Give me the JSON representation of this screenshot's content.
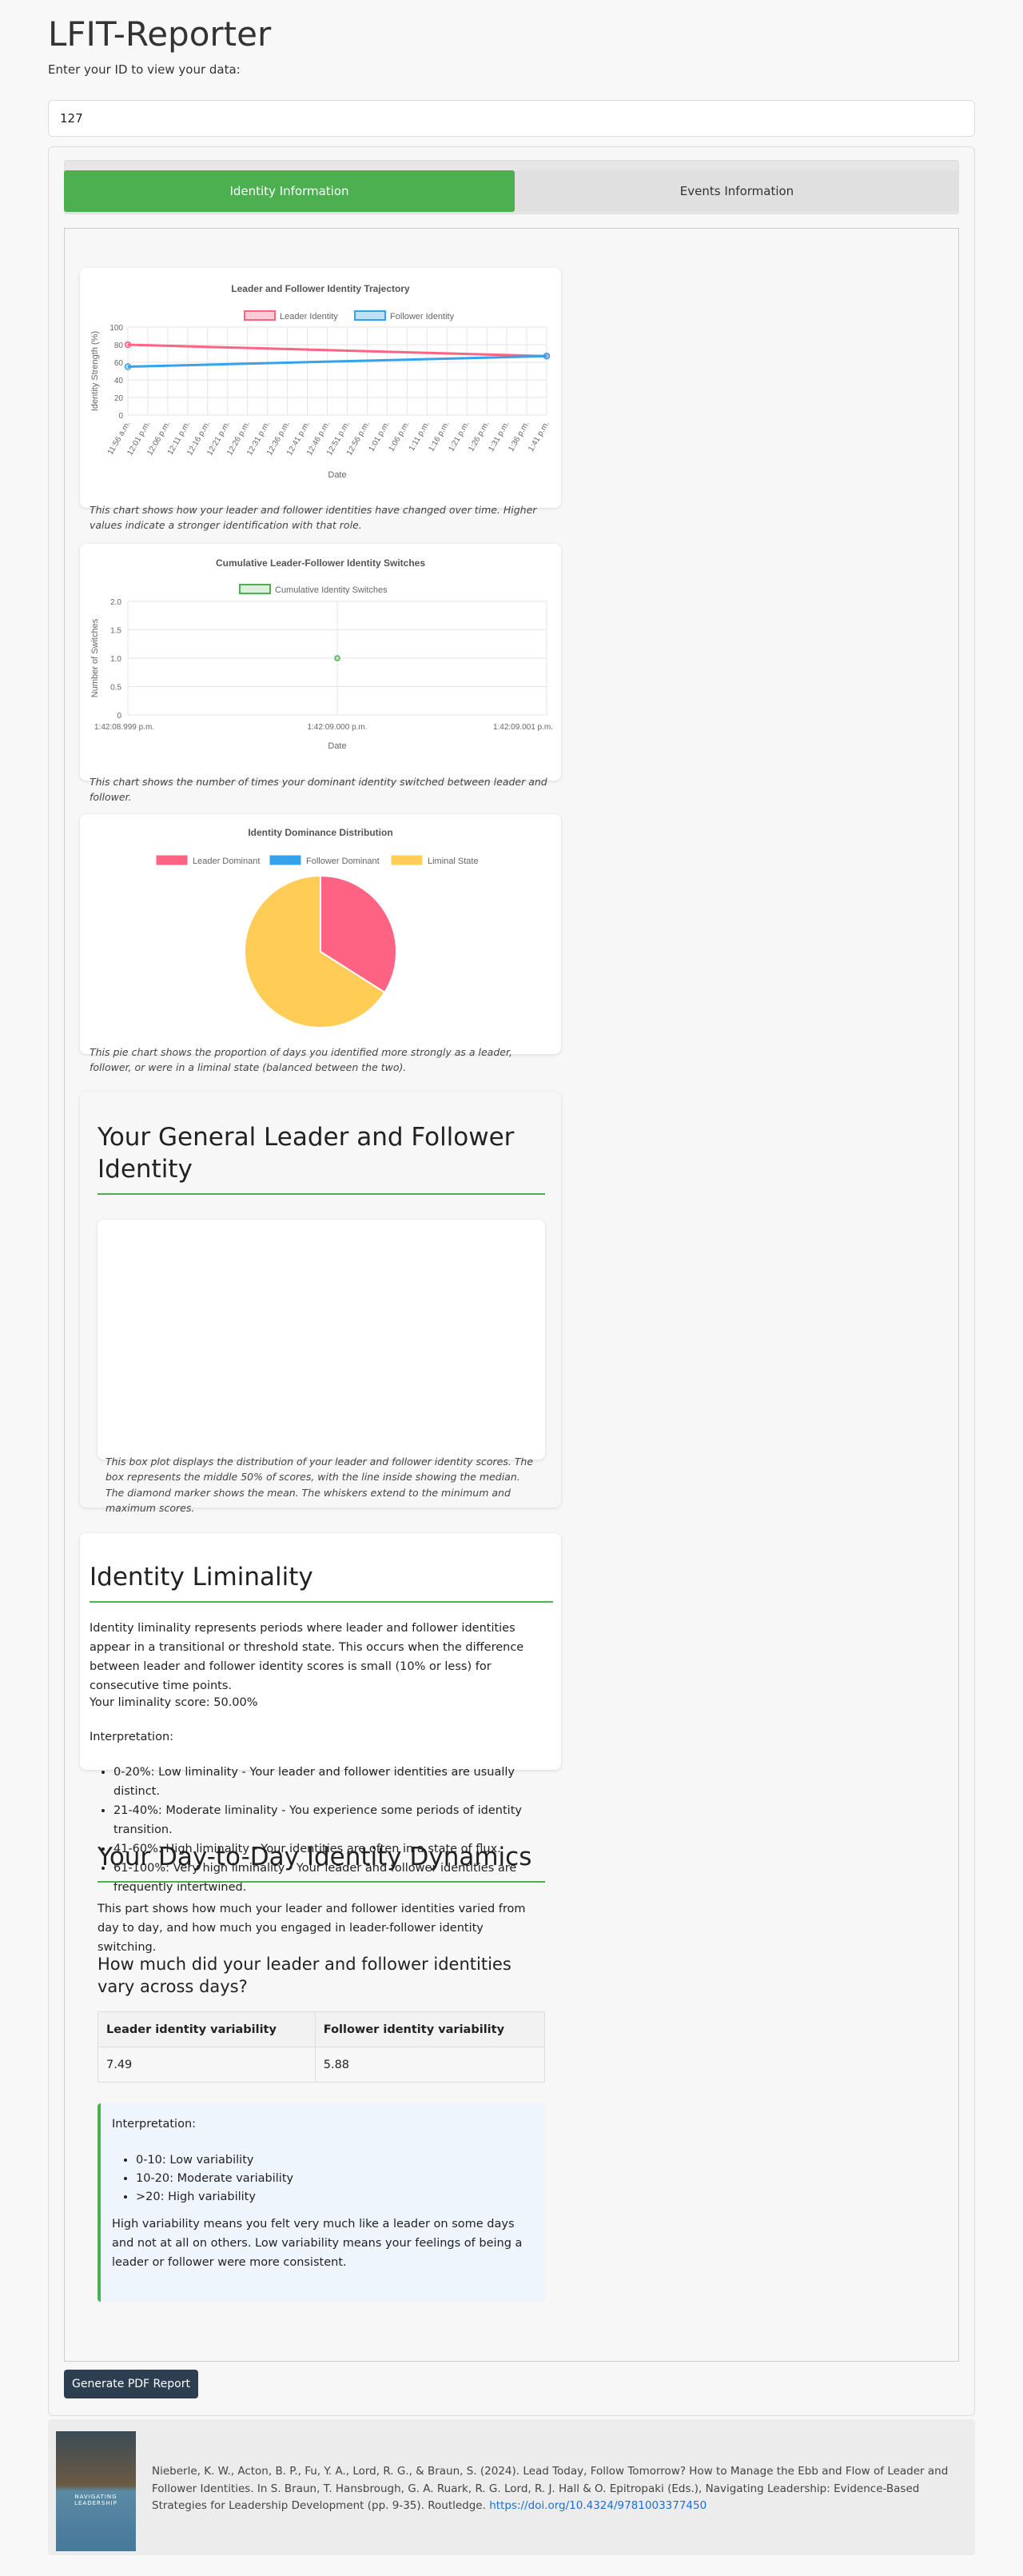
{
  "app": {
    "title": "LFIT-Reporter",
    "id_prompt": "Enter your ID to view your data:",
    "id_value": "127"
  },
  "tabs": [
    {
      "label": "Identity Information",
      "active": true
    },
    {
      "label": "Events Information",
      "active": false
    }
  ],
  "colors": {
    "accent": "#4caf50",
    "leader": "#ff6384",
    "follower": "#36a2eb",
    "liminal": "#ffcd56",
    "switches": "#4caf50"
  },
  "chart_data": [
    {
      "type": "line",
      "title": "Leader and Follower Identity Trajectory",
      "xlabel": "Date",
      "ylabel": "Identity Strength (%)",
      "ylim": [
        0,
        100
      ],
      "yticks": [
        "100",
        "80",
        "60",
        "40",
        "20",
        "0"
      ],
      "categories": [
        "11:56 a.m.",
        "12:01 p.m.",
        "12:06 p.m.",
        "12:11 p.m.",
        "12:16 p.m.",
        "12:21 p.m.",
        "12:26 p.m.",
        "12:31 p.m.",
        "12:36 p.m.",
        "12:41 p.m.",
        "12:46 p.m.",
        "12:51 p.m.",
        "12:56 p.m.",
        "1:01 p.m.",
        "1:06 p.m.",
        "1:11 p.m.",
        "1:16 p.m.",
        "1:21 p.m.",
        "1:26 p.m.",
        "1:31 p.m.",
        "1:36 p.m.",
        "1:41 p.m."
      ],
      "series": [
        {
          "name": "Leader Identity",
          "color": "#ff6384",
          "points": [
            {
              "x": "11:56 a.m.",
              "y": 80
            },
            {
              "x": "1:42 p.m.",
              "y": 67
            }
          ]
        },
        {
          "name": "Follower Identity",
          "color": "#36a2eb",
          "points": [
            {
              "x": "11:56 a.m.",
              "y": 55
            },
            {
              "x": "1:42 p.m.",
              "y": 67
            }
          ]
        }
      ],
      "legend": "top",
      "grid": true,
      "caption": "This chart shows how your leader and follower identities have changed over time. Higher values indicate a stronger identification with that role."
    },
    {
      "type": "scatter",
      "title": "Cumulative Leader-Follower Identity Switches",
      "xlabel": "Date",
      "ylabel": "Number of Switches",
      "ylim": [
        0,
        2
      ],
      "yticks": [
        "2.0",
        "1.5",
        "1.0",
        "0.5",
        "0"
      ],
      "xticks": [
        "1:42:08.999 p.m.",
        "1:42:09.000 p.m.",
        "1:42:09.001 p.m."
      ],
      "series": [
        {
          "name": "Cumulative Identity Switches",
          "color": "#4caf50",
          "points": [
            {
              "x": "1:42:09.000 p.m.",
              "y": 1
            }
          ]
        }
      ],
      "legend": "top",
      "grid": true,
      "caption": "This chart shows the number of times your dominant identity switched between leader and follower."
    },
    {
      "type": "pie",
      "title": "Identity Dominance Distribution",
      "categories": [
        "Leader Dominant",
        "Follower Dominant",
        "Liminal State"
      ],
      "values": [
        34,
        0,
        66
      ],
      "colors": [
        "#ff6384",
        "#36a2eb",
        "#ffcd56"
      ],
      "legend": "top",
      "caption": "This pie chart shows the proportion of days you identified more strongly as a leader, follower, or were in a liminal state (balanced between the two)."
    }
  ],
  "general_identity": {
    "title": "Your General Leader and Follower Identity",
    "caption": "This box plot displays the distribution of your leader and follower identity scores. The box represents the middle 50% of scores, with the line inside showing the median. The diamond marker shows the mean. The whiskers extend to the minimum and maximum scores."
  },
  "liminality": {
    "title": "Identity Liminality",
    "description": "Identity liminality represents periods where leader and follower identities appear in a transitional or threshold state. This occurs when the difference between leader and follower identity scores is small (10% or less) for consecutive time points.",
    "score_text": "Your liminality score: 50.00%",
    "interpretation_label": "Interpretation:",
    "items": [
      "0-20%: Low liminality - Your leader and follower identities are usually distinct.",
      "21-40%: Moderate liminality - You experience some periods of identity transition.",
      "41-60%: High liminality - Your identities are often in a state of flux.",
      "61-100%: Very high liminality - Your leader and follower identities are frequently intertwined."
    ]
  },
  "dynamics": {
    "title": "Your Day-to-Day Identity Dynamics",
    "intro": "This part shows how much your leader and follower identities varied from day to day, and how much you engaged in leader-follower identity switching.",
    "question": "How much did your leader and follower identities vary across days?",
    "table": {
      "headers": [
        "Leader identity variability",
        "Follower identity variability"
      ],
      "values": [
        "7.49",
        "5.88"
      ]
    },
    "interpretation_label": "Interpretation:",
    "items": [
      "0-10: Low variability",
      "10-20: Moderate variability",
      ">20: High variability"
    ],
    "explanation": "High variability means you felt very much like a leader on some days and not at all on others. Low variability means your feelings of being a leader or follower were more consistent."
  },
  "actions": {
    "pdf_button": "Generate PDF Report"
  },
  "footer": {
    "citation": "Nieberle, K. W., Acton, B. P., Fu, Y. A., Lord, R. G., & Braun, S. (2024). Lead Today, Follow Tomorrow? How to Manage the Ebb and Flow of Leader and Follower Identities. In S. Braun, T. Hansbrough, G. A. Ruark, R. G. Lord, R. J. Hall & O. Epitropaki (Eds.), Navigating Leadership: Evidence-Based Strategies for Leadership Development (pp. 9-35). Routledge.",
    "link": "https://doi.org/10.4324/9781003377450",
    "cover_text": "NAVIGATING LEADERSHIP"
  }
}
